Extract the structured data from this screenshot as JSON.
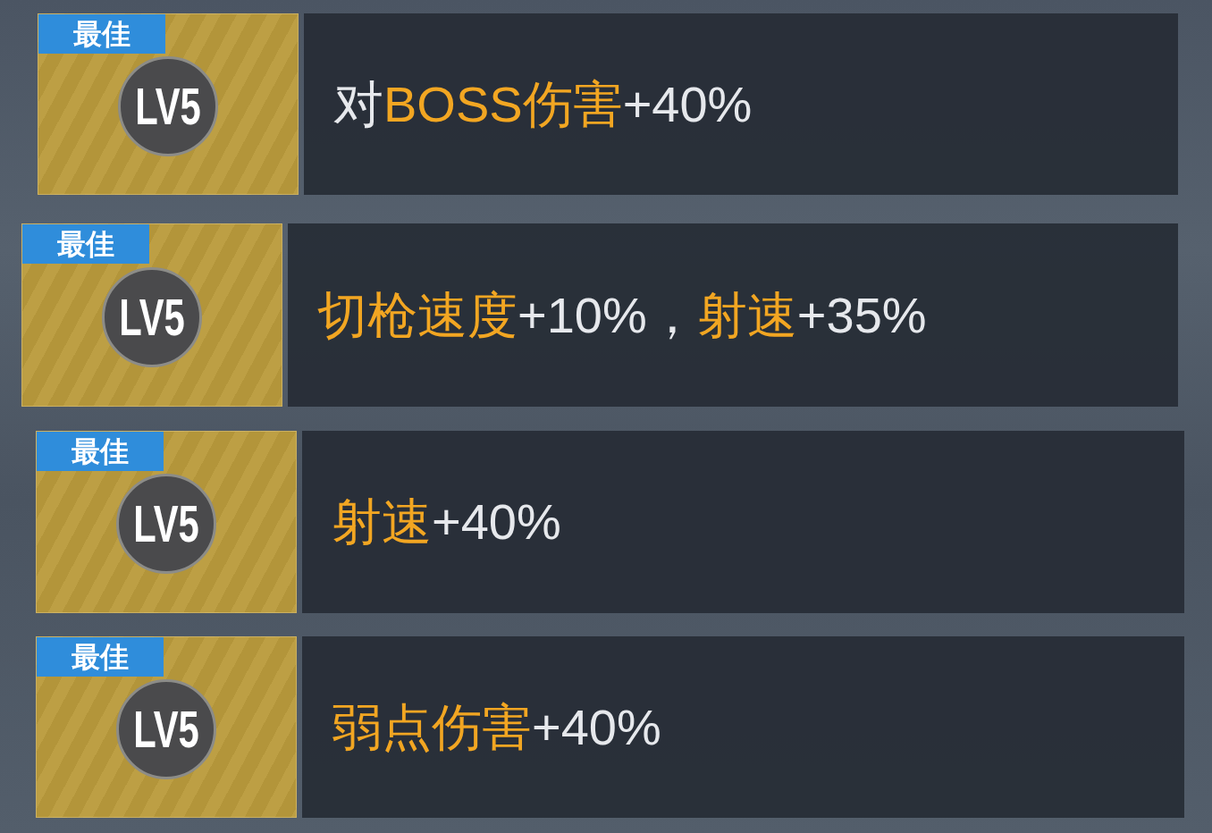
{
  "perks": [
    {
      "badge": "最佳",
      "level": "LV5",
      "description": [
        {
          "text": "对",
          "highlight": false
        },
        {
          "text": "BOSS伤害",
          "highlight": true
        },
        {
          "text": "+40%",
          "highlight": false
        }
      ]
    },
    {
      "badge": "最佳",
      "level": "LV5",
      "description": [
        {
          "text": "切枪速度",
          "highlight": true
        },
        {
          "text": "+10%，",
          "highlight": false
        },
        {
          "text": "射速",
          "highlight": true
        },
        {
          "text": "+35%",
          "highlight": false
        }
      ]
    },
    {
      "badge": "最佳",
      "level": "LV5",
      "description": [
        {
          "text": "射速",
          "highlight": true
        },
        {
          "text": "+40%",
          "highlight": false
        }
      ]
    },
    {
      "badge": "最佳",
      "level": "LV5",
      "description": [
        {
          "text": "弱点伤害",
          "highlight": true
        },
        {
          "text": "+40%",
          "highlight": false
        }
      ]
    }
  ]
}
